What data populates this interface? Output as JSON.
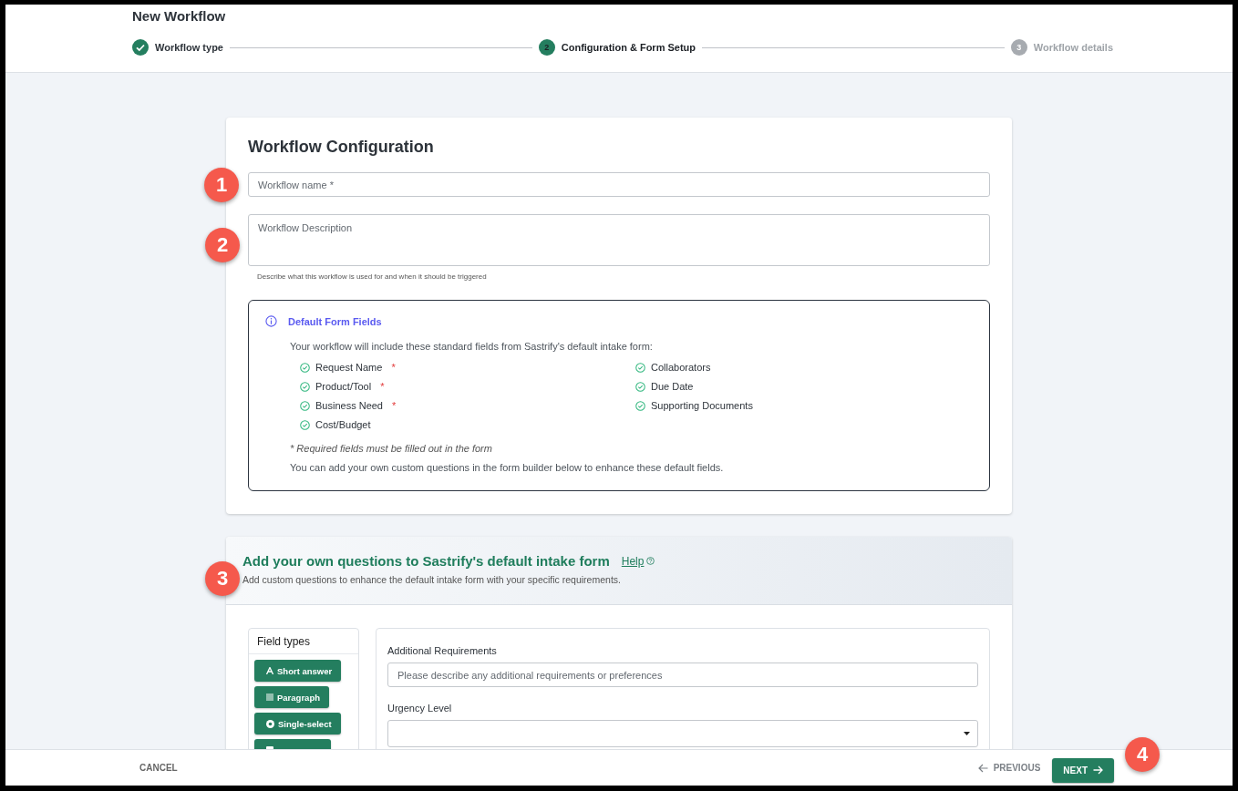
{
  "header": {
    "title": "New Workflow",
    "steps": [
      {
        "label": "Workflow type",
        "completed": true,
        "selected": false
      },
      {
        "number": "2",
        "label": "Configuration & Form Setup",
        "completed": false,
        "selected": true
      },
      {
        "number": "3",
        "label": "Workflow details",
        "completed": false,
        "selected": false
      }
    ]
  },
  "configuration": {
    "title": "Workflow Configuration",
    "name_field": {
      "placeholder": "Workflow name *"
    },
    "description_field": {
      "placeholder": "Workflow Description",
      "helper": "Describe what this workflow is used for and when it should be triggered"
    },
    "default_fields": {
      "title": "Default Form Fields",
      "intro": "Your workflow will include these standard fields from Sastrify's default intake form:",
      "columns": [
        [
          {
            "label": "Request Name",
            "required_mark": "*"
          },
          {
            "label": "Product/Tool",
            "required_mark": "*"
          },
          {
            "label": "Business Need",
            "required_mark": "*"
          },
          {
            "label": "Cost/Budget"
          }
        ],
        [
          {
            "label": "Collaborators"
          },
          {
            "label": "Due Date"
          },
          {
            "label": "Supporting Documents"
          }
        ]
      ],
      "note": "* Required fields must be filled out in the form",
      "footer": "You can add your own custom questions in the form builder below to enhance these default fields."
    }
  },
  "questions": {
    "title": "Add your own questions to Sastrify's default intake form",
    "help_link": "Help",
    "subtitle": "Add custom questions to enhance the default intake form with your specific requirements.",
    "field_types": {
      "title": "Field types",
      "items": [
        {
          "label": "Short answer",
          "kind": "short"
        },
        {
          "label": "Paragraph",
          "kind": "paragraph"
        },
        {
          "label": "Single-select",
          "kind": "single"
        },
        {
          "kind": "multi"
        }
      ]
    },
    "form": [
      {
        "kind": "text",
        "label": "Additional Requirements",
        "placeholder": "Please describe any additional requirements or preferences"
      },
      {
        "kind": "select",
        "label": "Urgency Level"
      }
    ]
  },
  "footer": {
    "cancel": "CANCEL",
    "previous": "PREVIOUS",
    "next": "NEXT"
  },
  "annotations": [
    "1",
    "2",
    "3",
    "4"
  ]
}
